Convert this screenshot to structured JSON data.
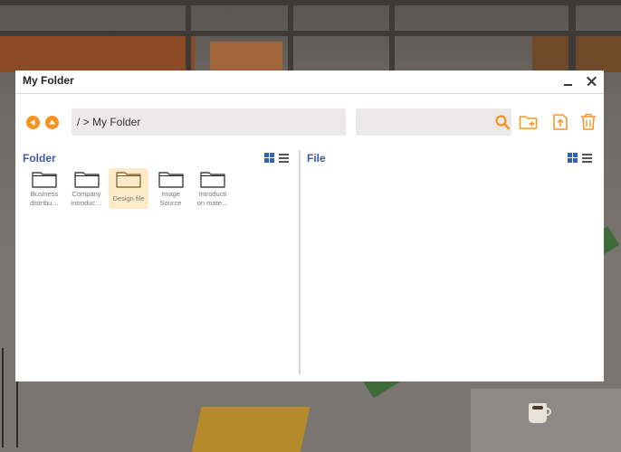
{
  "window": {
    "title": "My Folder",
    "minimize_icon": "minimize-icon",
    "close_icon": "close-icon"
  },
  "toolbar": {
    "back_icon": "back-arrow-icon",
    "up_icon": "up-arrow-icon",
    "path": "/ > My Folder",
    "search_value": "",
    "search_icon": "search-icon",
    "new_folder_icon": "new-folder-icon",
    "upload_icon": "upload-icon",
    "delete_icon": "trash-icon"
  },
  "folder_panel": {
    "title": "Folder",
    "items": [
      {
        "label_line1": "Business",
        "label_line2": "distribu…",
        "selected": false
      },
      {
        "label_line1": "Company",
        "label_line2": "introduc…",
        "selected": false
      },
      {
        "label_line1": "Design file",
        "label_line2": "",
        "selected": true
      },
      {
        "label_line1": "Image",
        "label_line2": "Source",
        "selected": false
      },
      {
        "label_line1": "introducti",
        "label_line2": "on mate…",
        "selected": false
      }
    ]
  },
  "file_panel": {
    "title": "File",
    "items": []
  },
  "colors": {
    "accent": "#f7931e",
    "panel_title": "#3b5aa8",
    "selected_bg": "#fdebc8",
    "input_bg": "#ece9ea"
  }
}
